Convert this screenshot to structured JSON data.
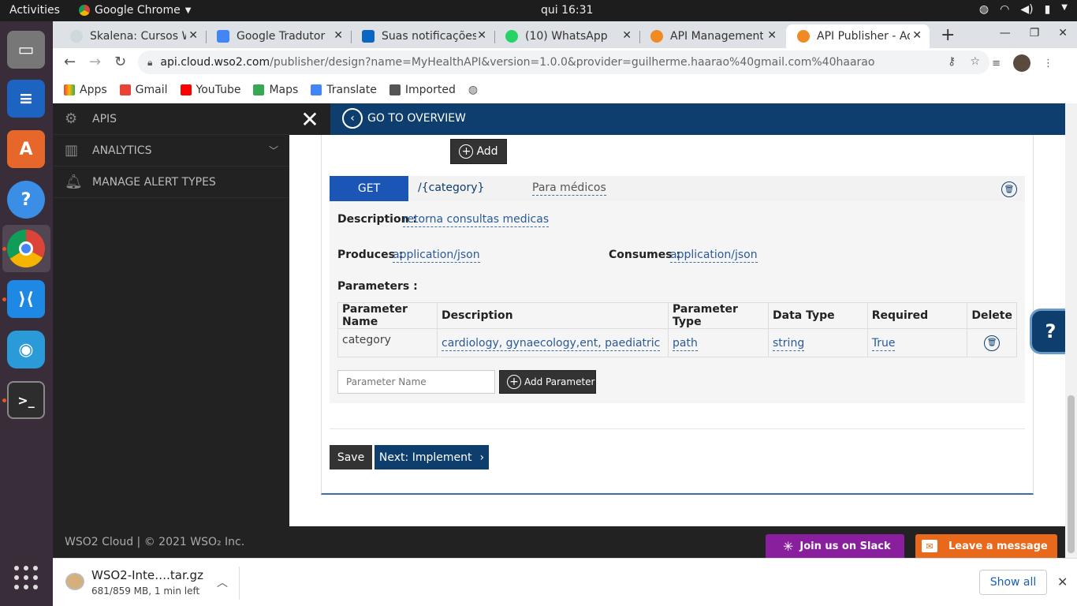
{
  "os": {
    "activities": "Activities",
    "app_menu": "Google Chrome",
    "clock": "qui 16:31"
  },
  "browser": {
    "tabs": [
      {
        "label": "Skalena: Cursos W",
        "active": false
      },
      {
        "label": "Google Tradutor",
        "active": false
      },
      {
        "label": "Suas notificações",
        "active": false
      },
      {
        "label": "(10) WhatsApp",
        "active": false
      },
      {
        "label": "API Management",
        "active": false
      },
      {
        "label": "API Publisher - Ad",
        "active": true
      }
    ],
    "url_host": "api.cloud.wso2.com",
    "url_path": "/publisher/design?name=MyHealthAPI&version=1.0.0&provider=guilherme.haarao%40gmail.com%40haarao",
    "bookmarks": [
      "Apps",
      "Gmail",
      "YouTube",
      "Maps",
      "Translate",
      "Imported"
    ]
  },
  "sidebar": {
    "items": [
      {
        "label": "APIS",
        "icon": "gear-api-icon"
      },
      {
        "label": "ANALYTICS",
        "icon": "bar-chart-icon"
      },
      {
        "label": "MANAGE ALERT TYPES",
        "icon": "bell-icon"
      }
    ]
  },
  "header": {
    "go_to_overview": "GO TO OVERVIEW"
  },
  "resource": {
    "add_label": "Add",
    "method": "GET",
    "path": "/{category}",
    "summary": "Para médicos",
    "description_label": "Description :",
    "description": "retorna consultas medicas",
    "produces_label": "Produces :",
    "produces": "application/json",
    "consumes_label": "Consumes :",
    "consumes": "application/json",
    "parameters_label": "Parameters :",
    "param_headers": [
      "Parameter Name",
      "Description",
      "Parameter Type",
      "Data Type",
      "Required",
      "Delete"
    ],
    "params": [
      {
        "name": "category",
        "description": "cardiology, gynaecology,ent, paediatric",
        "type": "path",
        "data_type": "string",
        "required": "True"
      }
    ],
    "param_placeholder": "Parameter Name",
    "add_parameter_label": "Add Parameter"
  },
  "actions": {
    "save": "Save",
    "next": "Next: Implement"
  },
  "help_tab": "?",
  "footer": {
    "copyright": "WSO2 Cloud | © 2021 WSO₂ Inc.",
    "slack": "Join us on Slack",
    "leave_message": "Leave a message"
  },
  "download": {
    "filename": "WSO2-Inte….tar.gz",
    "status": "681/859 MB, 1 min left",
    "show_all": "Show all"
  }
}
